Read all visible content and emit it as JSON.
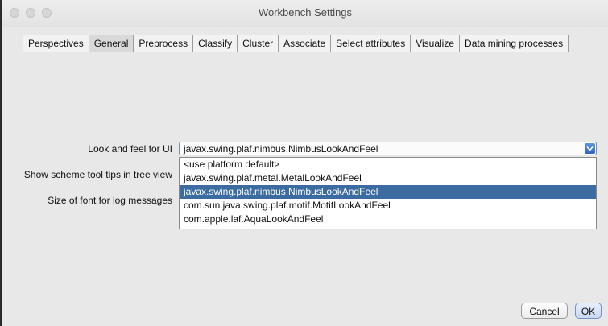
{
  "window": {
    "title": "Workbench Settings"
  },
  "tabs": [
    {
      "label": "Perspectives",
      "active": false
    },
    {
      "label": "General",
      "active": true
    },
    {
      "label": "Preprocess",
      "active": false
    },
    {
      "label": "Classify",
      "active": false
    },
    {
      "label": "Cluster",
      "active": false
    },
    {
      "label": "Associate",
      "active": false
    },
    {
      "label": "Select attributes",
      "active": false
    },
    {
      "label": "Visualize",
      "active": false
    },
    {
      "label": "Data mining processes",
      "active": false
    }
  ],
  "settings": {
    "look_and_feel_label": "Look and feel for UI",
    "tooltips_label": "Show scheme tool tips in tree view",
    "font_size_label": "Size of font for log messages",
    "look_and_feel_value": "javax.swing.plaf.nimbus.NimbusLookAndFeel"
  },
  "dropdown": {
    "options": [
      "<use platform default>",
      "javax.swing.plaf.metal.MetalLookAndFeel",
      "javax.swing.plaf.nimbus.NimbusLookAndFeel",
      "com.sun.java.swing.plaf.motif.MotifLookAndFeel",
      "com.apple.laf.AquaLookAndFeel"
    ],
    "selected_index": 2
  },
  "buttons": {
    "cancel": "Cancel",
    "ok": "OK"
  },
  "colors": {
    "selection": "#3b6ba0",
    "combo_arrow": "#2f64c4"
  }
}
